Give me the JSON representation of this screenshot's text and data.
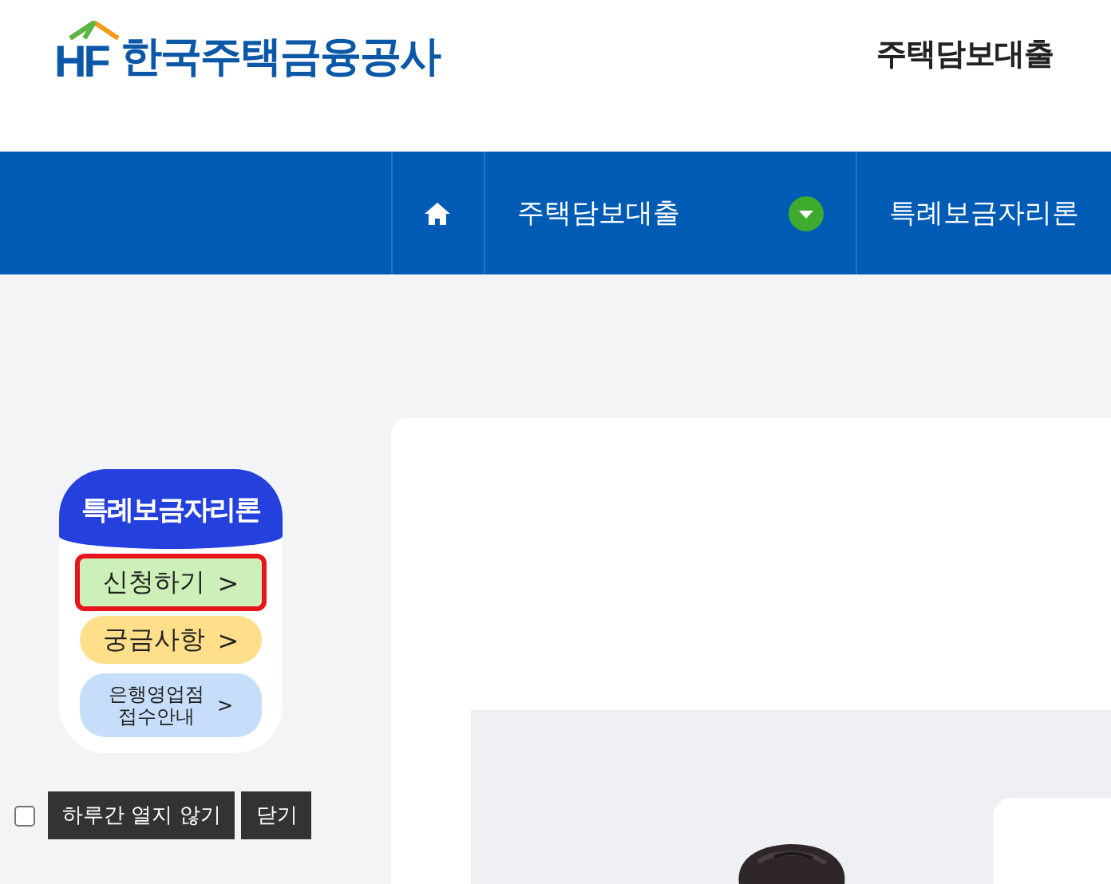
{
  "header": {
    "logo_mark": "HF",
    "logo_text": "한국주택금융공사",
    "page_title": "주택담보대출"
  },
  "nav": {
    "items": [
      {
        "kind": "home"
      },
      {
        "kind": "dropdown",
        "label": "주택담보대출"
      },
      {
        "kind": "link",
        "label": "특례보금자리론"
      }
    ]
  },
  "popup": {
    "title": "특례보금자리론",
    "buttons": [
      {
        "lines": [
          "신청하기"
        ],
        "arrow": ">",
        "color": "#cdefb8",
        "focused": true
      },
      {
        "lines": [
          "궁금사항"
        ],
        "arrow": ">",
        "color": "#ffdf8a",
        "focused": false
      },
      {
        "lines": [
          "은행영업점",
          "접수안내"
        ],
        "arrow": ">",
        "color": "#c6def9",
        "focused": false
      }
    ],
    "dont_show_today": {
      "label": "하루간 열지 않기",
      "checked": false
    },
    "close": "닫기"
  }
}
